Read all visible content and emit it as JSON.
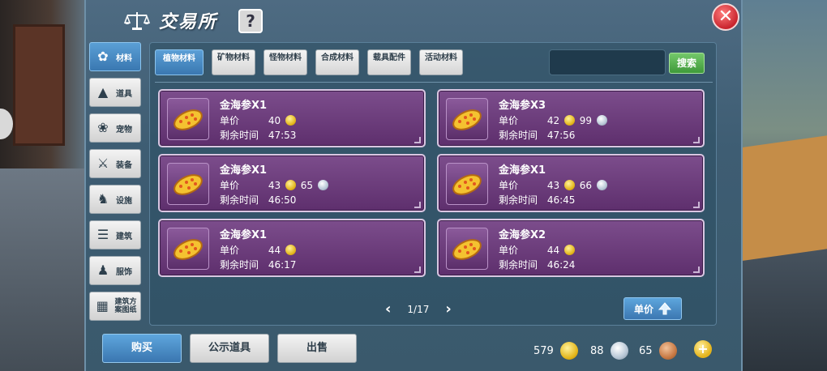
{
  "header": {
    "title": "交易所",
    "help_label": "?",
    "close_label": "✕"
  },
  "categories": [
    {
      "label": "材料",
      "icon": "materials-icon",
      "active": true
    },
    {
      "label": "道具",
      "icon": "items-icon"
    },
    {
      "label": "宠物",
      "icon": "pet-paw-icon"
    },
    {
      "label": "装备",
      "icon": "equipment-icon"
    },
    {
      "label": "设施",
      "icon": "facility-icon"
    },
    {
      "label": "建筑",
      "icon": "building-icon"
    },
    {
      "label": "服饰",
      "icon": "clothing-icon"
    },
    {
      "label": "建筑方案图纸",
      "icon": "blueprint-icon"
    }
  ],
  "subtabs": [
    {
      "label": "植物材料",
      "active": true
    },
    {
      "label": "矿物材料"
    },
    {
      "label": "怪物材料"
    },
    {
      "label": "合成材料"
    },
    {
      "label": "载具配件"
    },
    {
      "label": "活动材料"
    }
  ],
  "search": {
    "value": "",
    "button_label": "搜索"
  },
  "listing_labels": {
    "price": "单价",
    "time_left": "剩余时间"
  },
  "listings": [
    {
      "name": "金海参X1",
      "gold": "40",
      "silver": "",
      "time_left": "47:53"
    },
    {
      "name": "金海参X3",
      "gold": "42",
      "silver": "99",
      "time_left": "47:56"
    },
    {
      "name": "金海参X1",
      "gold": "43",
      "silver": "65",
      "time_left": "46:50"
    },
    {
      "name": "金海参X1",
      "gold": "43",
      "silver": "66",
      "time_left": "46:45"
    },
    {
      "name": "金海参X1",
      "gold": "44",
      "silver": "",
      "time_left": "46:17"
    },
    {
      "name": "金海参X2",
      "gold": "44",
      "silver": "",
      "time_left": "46:24"
    }
  ],
  "pagination": {
    "prev": "‹",
    "page_text": "1/17",
    "next": "›"
  },
  "sort_button": {
    "label": "单价"
  },
  "bottom_buttons": {
    "buy": "购买",
    "public": "公示道具",
    "sell": "出售"
  },
  "currency": {
    "gold": "579",
    "silver": "88",
    "copper": "65",
    "add_label": "+"
  },
  "colors": {
    "card_bg": "#6e3f7e",
    "active_tab": "#3a78b1",
    "search_button": "#4aa245",
    "close": "#c9252e"
  }
}
